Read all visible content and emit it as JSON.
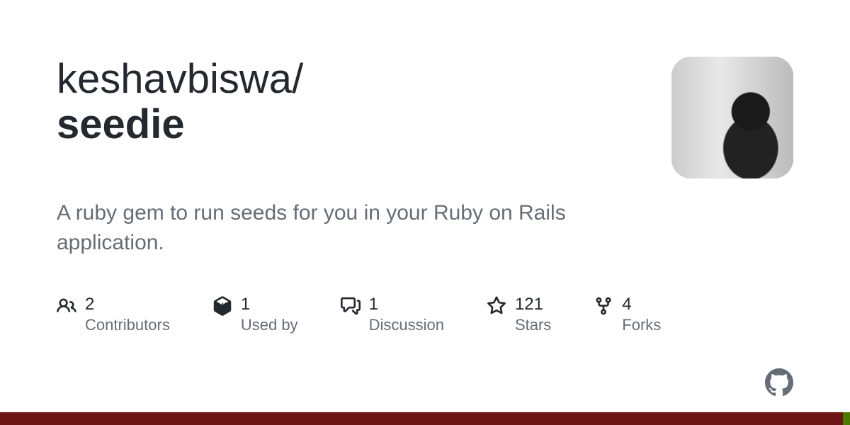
{
  "repo": {
    "owner": "keshavbiswa",
    "slash": "/",
    "name": "seedie"
  },
  "description": "A ruby gem to run seeds for you in your Ruby on Rails application.",
  "stats": {
    "contributors": {
      "count": "2",
      "label": "Contributors"
    },
    "usedby": {
      "count": "1",
      "label": "Used by"
    },
    "discussion": {
      "count": "1",
      "label": "Discussion"
    },
    "stars": {
      "count": "121",
      "label": "Stars"
    },
    "forks": {
      "count": "4",
      "label": "Forks"
    }
  }
}
